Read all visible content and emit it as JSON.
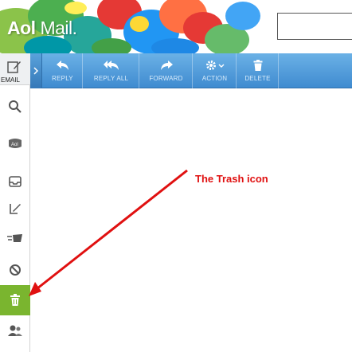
{
  "app": {
    "logo_aol": "Aol",
    "logo_mail": "Mail."
  },
  "compose": {
    "label": "EMAIL",
    "icon": "compose-icon"
  },
  "toolbar": {
    "collapse_icon": "chevron-right-icon",
    "buttons": [
      {
        "label": "REPLY",
        "icon": "reply-icon"
      },
      {
        "label": "REPLY ALL",
        "icon": "reply-all-icon"
      },
      {
        "label": "FORWARD",
        "icon": "forward-icon"
      },
      {
        "label": "ACTION",
        "icon": "gear-icon"
      },
      {
        "label": "DELETE",
        "icon": "trash-icon"
      }
    ]
  },
  "rail": {
    "items": [
      {
        "icon": "search-icon"
      },
      {
        "icon": "aol-inbox-icon"
      },
      {
        "icon": "inbox-tray-icon"
      },
      {
        "icon": "drafts-icon"
      },
      {
        "icon": "sent-icon"
      },
      {
        "icon": "spam-icon"
      },
      {
        "icon": "trash-icon",
        "active": true
      },
      {
        "icon": "contacts-icon"
      }
    ]
  },
  "annotation": {
    "text": "The Trash icon",
    "color": "#e01010"
  },
  "colors": {
    "toolbar": "#4a97d8",
    "active_rail": "#7ab52f"
  }
}
